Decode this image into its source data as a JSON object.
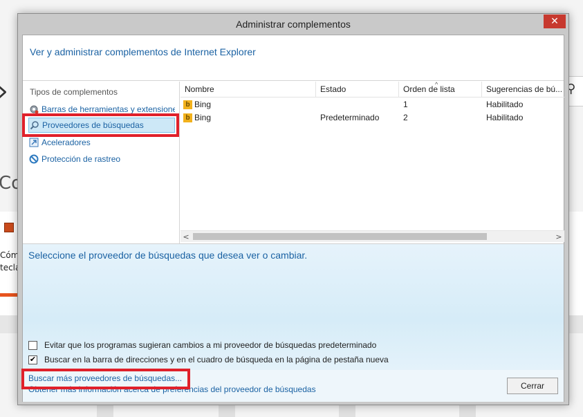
{
  "dialog": {
    "title": "Administrar complementos",
    "close_glyph": "✕",
    "header": "Ver y administrar complementos de Internet Explorer"
  },
  "addon_types": {
    "label": "Tipos de complementos",
    "items": [
      {
        "label": "Barras de herramientas y extensiones",
        "icon": "gear-icon",
        "selected": false
      },
      {
        "label": "Proveedores de búsquedas",
        "icon": "search-icon",
        "selected": true
      },
      {
        "label": "Aceleradores",
        "icon": "accelerator-icon",
        "selected": false
      },
      {
        "label": "Protección de rastreo",
        "icon": "block-icon",
        "selected": false
      }
    ]
  },
  "table": {
    "columns": [
      "Nombre",
      "Estado",
      "Orden de lista",
      "Sugerencias de bú..."
    ],
    "sort_glyph": "^",
    "rows": [
      {
        "name": "Bing",
        "status": "",
        "order": "1",
        "suggestions": "Habilitado"
      },
      {
        "name": "Bing",
        "status": "Predeterminado",
        "order": "2",
        "suggestions": "Habilitado"
      }
    ],
    "scroll_left": "<",
    "scroll_right": ">"
  },
  "details": {
    "title": "Seleccione el proveedor de búsquedas que desea ver o cambiar.",
    "checkbox1": {
      "label": "Evitar que los programas sugieran cambios a mi proveedor de búsquedas predeterminado",
      "checked": false
    },
    "checkbox2": {
      "label": "Buscar en la barra de direcciones y en el cuadro de búsqueda en la página de pestaña nueva",
      "checked": true,
      "mark": "✔"
    }
  },
  "footer": {
    "link1": "Buscar más proveedores de búsquedas...",
    "link2": "Obtener más información acerca de preferencias del proveedor de búsquedas",
    "close_label": "Cerrar"
  },
  "background": {
    "arrow_glyph": "›",
    "co_text": "Co",
    "text1": "Cóm",
    "text2": "tecla",
    "right_icon_glyph": "⚲"
  },
  "colors": {
    "accent": "#1b62a3",
    "highlight": "#e0202a",
    "bing": "#f2b11c",
    "titlebar_close": "#c7392f"
  }
}
